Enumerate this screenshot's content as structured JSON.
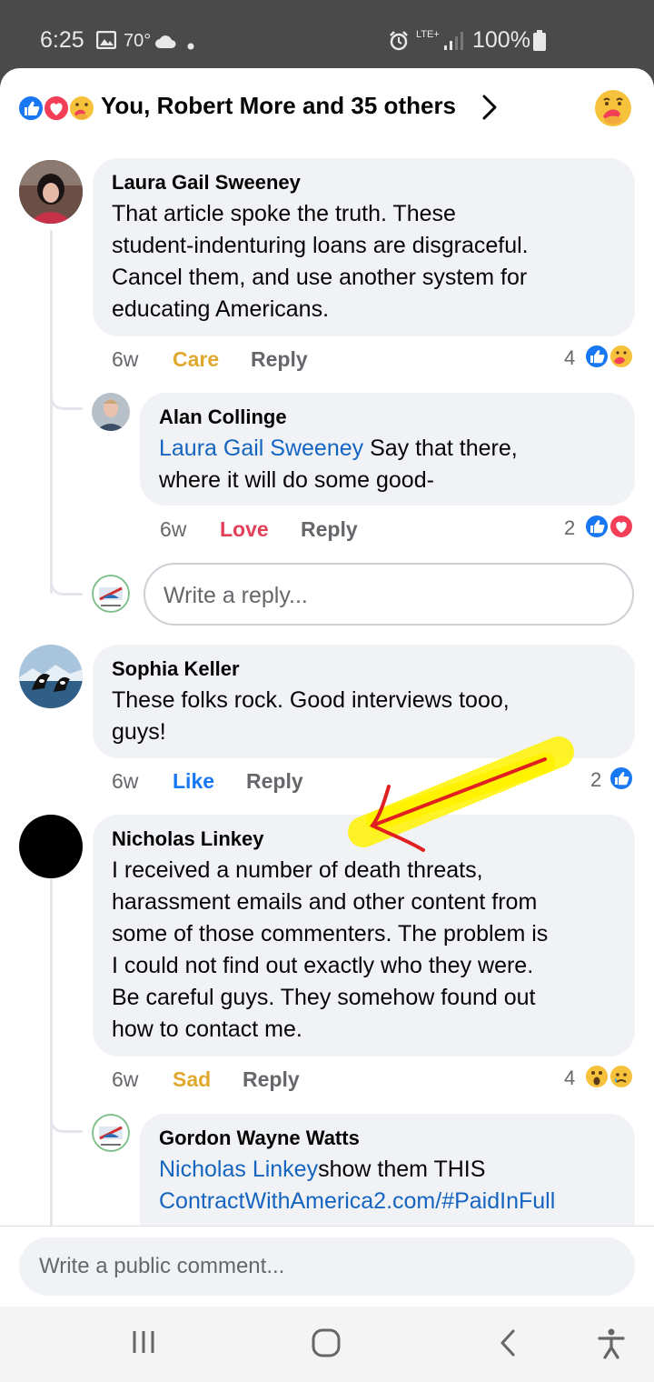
{
  "status_bar": {
    "time": "6:25",
    "temperature": "70°",
    "network": "LTE+",
    "battery": "100%"
  },
  "reactions": {
    "summary": "You, Robert More and 35 others",
    "icons": [
      "like-icon",
      "love-icon",
      "care-icon"
    ]
  },
  "comments": [
    {
      "author": "Laura Gail Sweeney",
      "text": "That article spoke the truth. These\nstudent-indenturing loans are disgraceful.\nCancel them, and use another system for\neducating Americans.",
      "age": "6w",
      "reaction_label": "Care",
      "reply_label": "Reply",
      "reaction_count": "4",
      "reply": {
        "author": "Alan Collinge",
        "mention": "Laura Gail Sweeney",
        "text": " Say that there,\nwhere it will do some good-",
        "age": "6w",
        "reaction_label": "Love",
        "reply_label": "Reply",
        "reaction_count": "2"
      },
      "reply_placeholder": "Write a reply..."
    },
    {
      "author": "Sophia Keller",
      "text": "These folks rock.  Good interviews tooo,\nguys!",
      "age": "6w",
      "reaction_label": "Like",
      "reply_label": "Reply",
      "reaction_count": "2"
    },
    {
      "author": "Nicholas Linkey",
      "text": "I received a number of death threats,\nharassment emails and other content from\nsome of those commenters. The problem is\nI could not find out exactly who they were.\nBe careful guys. They somehow found out\nhow to contact me.",
      "age": "6w",
      "reaction_label": "Sad",
      "reply_label": "Reply",
      "reaction_count": "4",
      "reply": {
        "author": "Gordon Wayne Watts",
        "mention": "Nicholas Linkey",
        "text": "show them THIS",
        "link": "ContractWithAmerica2.com/#PaidInFull"
      }
    }
  ],
  "composer": {
    "placeholder": "Write a public comment..."
  },
  "colors": {
    "care": "#e0a82e",
    "love": "#e2405a",
    "like": "#1877f2",
    "sad": "#e0a82e",
    "bubble": "#f0f2f5"
  }
}
